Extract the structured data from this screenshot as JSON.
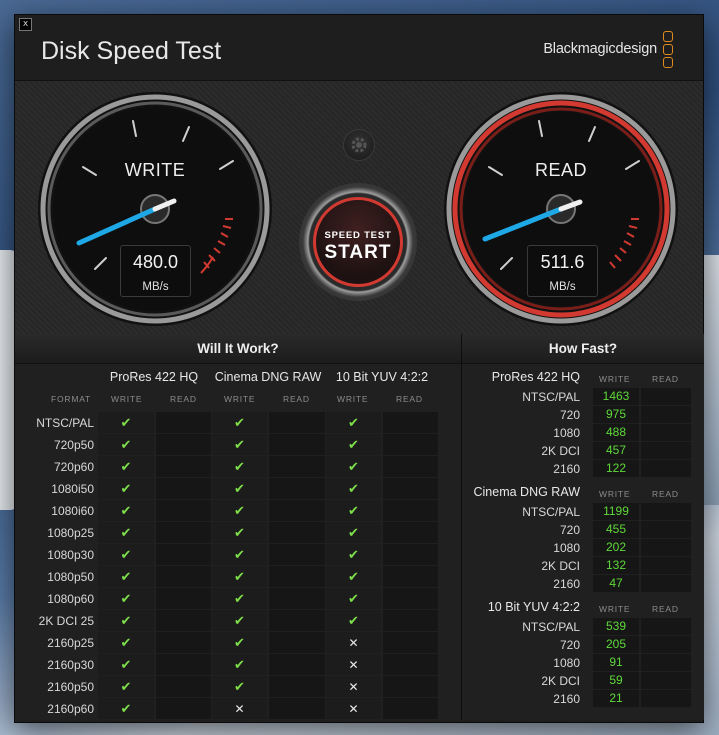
{
  "window": {
    "title": "Disk Speed Test",
    "brand": "Blackmagicdesign",
    "close_label": "x"
  },
  "gauges": {
    "write": {
      "label": "WRITE",
      "value": "480.0",
      "unit": "MB/s"
    },
    "read": {
      "label": "READ",
      "value": "511.6",
      "unit": "MB/s"
    }
  },
  "start_button": {
    "top": "SPEED TEST",
    "main": "START"
  },
  "will_it_work": {
    "title": "Will It Work?",
    "format_label": "FORMAT",
    "groups": [
      "ProRes 422 HQ",
      "Cinema DNG RAW",
      "10 Bit YUV 4:2:2"
    ],
    "write_label": "WRITE",
    "read_label": "READ",
    "rows": [
      {
        "format": "NTSC/PAL",
        "marks": [
          "✔",
          "✔",
          "✔"
        ]
      },
      {
        "format": "720p50",
        "marks": [
          "✔",
          "✔",
          "✔"
        ]
      },
      {
        "format": "720p60",
        "marks": [
          "✔",
          "✔",
          "✔"
        ]
      },
      {
        "format": "1080i50",
        "marks": [
          "✔",
          "✔",
          "✔"
        ]
      },
      {
        "format": "1080i60",
        "marks": [
          "✔",
          "✔",
          "✔"
        ]
      },
      {
        "format": "1080p25",
        "marks": [
          "✔",
          "✔",
          "✔"
        ]
      },
      {
        "format": "1080p30",
        "marks": [
          "✔",
          "✔",
          "✔"
        ]
      },
      {
        "format": "1080p50",
        "marks": [
          "✔",
          "✔",
          "✔"
        ]
      },
      {
        "format": "1080p60",
        "marks": [
          "✔",
          "✔",
          "✔"
        ]
      },
      {
        "format": "2K DCI 25",
        "marks": [
          "✔",
          "✔",
          "✔"
        ]
      },
      {
        "format": "2160p25",
        "marks": [
          "✔",
          "✔",
          "✕"
        ]
      },
      {
        "format": "2160p30",
        "marks": [
          "✔",
          "✔",
          "✕"
        ]
      },
      {
        "format": "2160p50",
        "marks": [
          "✔",
          "✔",
          "✕"
        ]
      },
      {
        "format": "2160p60",
        "marks": [
          "✔",
          "✕",
          "✕"
        ]
      }
    ]
  },
  "how_fast": {
    "title": "How Fast?",
    "write_label": "WRITE",
    "read_label": "READ",
    "sections": [
      {
        "name": "ProRes 422 HQ",
        "rows": [
          {
            "format": "NTSC/PAL",
            "write": "1463"
          },
          {
            "format": "720",
            "write": "975"
          },
          {
            "format": "1080",
            "write": "488"
          },
          {
            "format": "2K DCI",
            "write": "457"
          },
          {
            "format": "2160",
            "write": "122"
          }
        ]
      },
      {
        "name": "Cinema DNG RAW",
        "rows": [
          {
            "format": "NTSC/PAL",
            "write": "1199"
          },
          {
            "format": "720",
            "write": "455"
          },
          {
            "format": "1080",
            "write": "202"
          },
          {
            "format": "2K DCI",
            "write": "132"
          },
          {
            "format": "2160",
            "write": "47"
          }
        ]
      },
      {
        "name": "10 Bit YUV 4:2:2",
        "rows": [
          {
            "format": "NTSC/PAL",
            "write": "539"
          },
          {
            "format": "720",
            "write": "205"
          },
          {
            "format": "1080",
            "write": "91"
          },
          {
            "format": "2K DCI",
            "write": "59"
          },
          {
            "format": "2160",
            "write": "21"
          }
        ]
      }
    ]
  },
  "colors": {
    "accent_red": "#d23a31",
    "needle_blue": "#1fa8e6",
    "check_green": "#7ee04a",
    "speed_green": "#5fd83a",
    "brand_orange": "#e08a1e"
  }
}
